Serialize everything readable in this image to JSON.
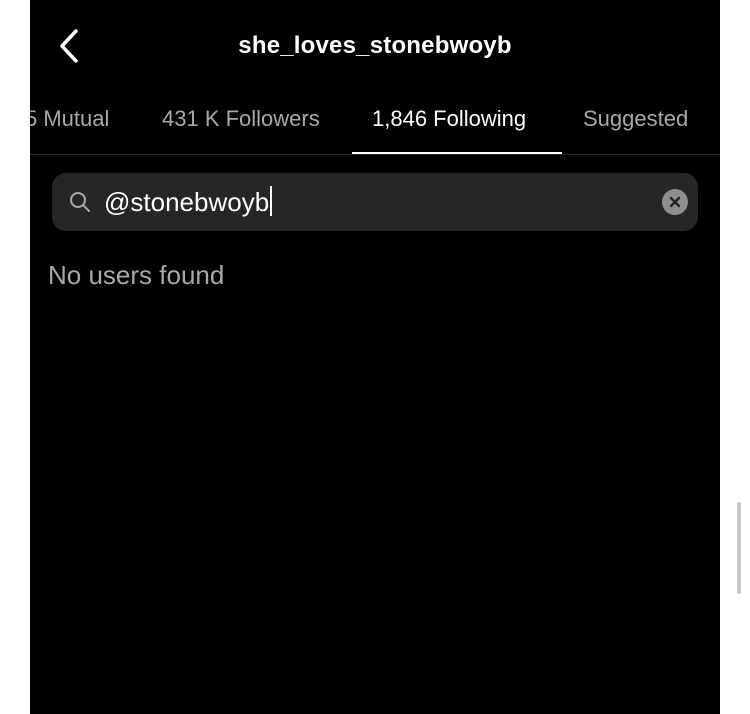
{
  "header": {
    "title": "she_loves_stonebwoyb",
    "back_icon": "chevron-left-icon"
  },
  "tabs": [
    {
      "label": "5 Mutual",
      "active": false
    },
    {
      "label": "431 K Followers",
      "active": false
    },
    {
      "label": "1,846 Following",
      "active": true
    },
    {
      "label": "Suggested",
      "active": false
    }
  ],
  "search": {
    "value": "@stonebwoyb",
    "icon": "search-icon",
    "clear_icon": "clear-icon"
  },
  "results": {
    "empty_message": "No users found"
  },
  "colors": {
    "background": "#000000",
    "search_bg": "#262626",
    "inactive_text": "#a8a8a8",
    "active_text": "#ffffff"
  }
}
